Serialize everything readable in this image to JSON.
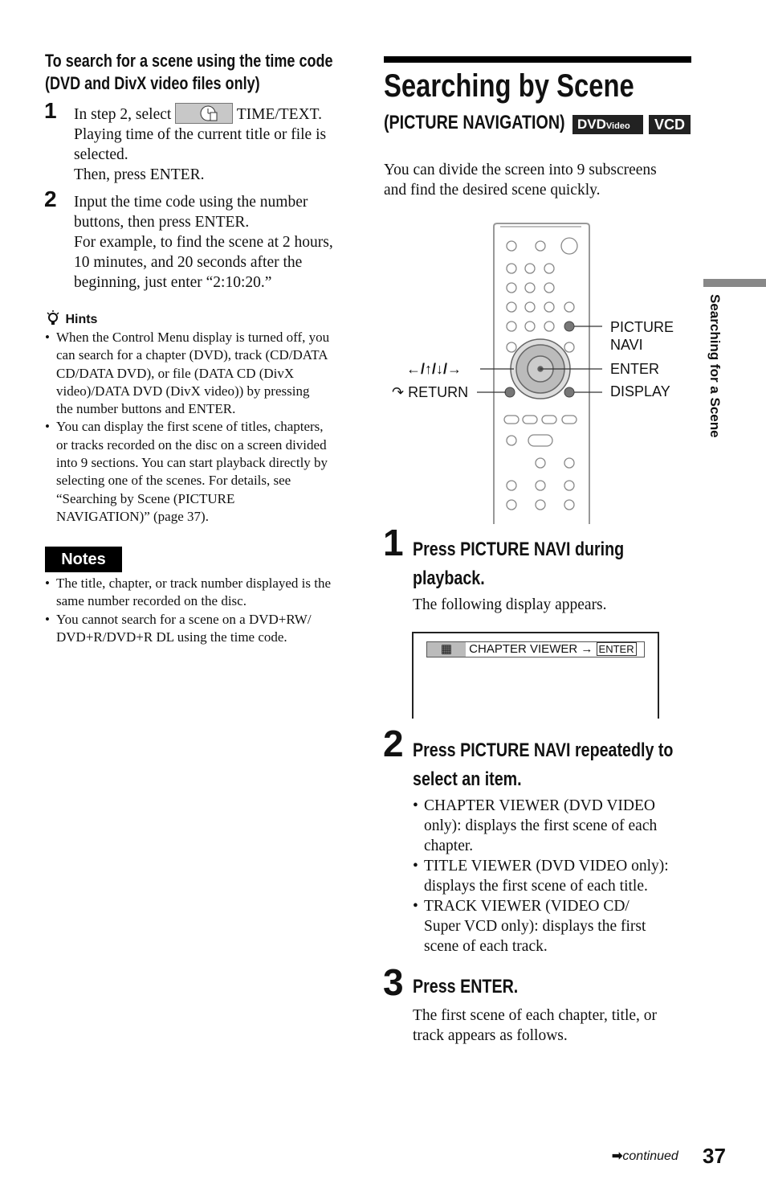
{
  "left": {
    "heading_line1": "To search for a scene using the time code",
    "heading_line2": "(DVD and DivX video files only)",
    "steps": [
      {
        "num": "1",
        "pre": "In step 2, select",
        "post": "TIME/TEXT.",
        "rest": [
          "Playing time of the current title or file is",
          "selected.",
          "Then, press ENTER."
        ]
      },
      {
        "num": "2",
        "lines": [
          "Input the time code using the number",
          "buttons, then press ENTER.",
          "For example, to find the scene at 2 hours,",
          "10 minutes, and 20 seconds after the",
          "beginning, just enter “2:10:20.”"
        ]
      }
    ],
    "hints_title": "Hints",
    "hints": [
      {
        "lines": [
          "When the Control Menu display is turned off, you",
          "can search for a chapter (DVD), track (CD/DATA",
          "CD/DATA DVD), or file (DATA CD (DivX",
          "video)/DATA DVD (DivX video)) by pressing",
          "the number buttons and ENTER."
        ]
      },
      {
        "lines": [
          "You can display the first scene of titles, chapters,",
          "or tracks recorded on the disc on a screen divided",
          "into 9 sections. You can start playback directly by",
          "selecting one of the scenes. For details, see",
          "“Searching by Scene (PICTURE",
          "NAVIGATION)” (page 37)."
        ]
      }
    ],
    "notes_title": "Notes",
    "notes": [
      {
        "lines": [
          "The title, chapter, or track number displayed is the",
          "same number recorded on the disc."
        ]
      },
      {
        "lines": [
          "You cannot search for a scene on a DVD+RW/",
          "DVD+R/DVD+R DL using the time code."
        ]
      }
    ]
  },
  "right": {
    "title": "Searching by Scene",
    "subtitle": "(PICTURE NAVIGATION)",
    "badges": {
      "dvd": "DVD",
      "dvd_small": "Video",
      "vcd": "VCD"
    },
    "intro": [
      "You can divide the screen into 9 subscreens",
      "and find the desired scene quickly."
    ],
    "remote_labels": {
      "picture_navi": [
        "PICTURE",
        "NAVI"
      ],
      "enter": "ENTER",
      "display": "DISPLAY",
      "arrows": "←/↑/↓/→",
      "return": "RETURN"
    },
    "step1": {
      "num": "1",
      "title": "Press PICTURE NAVI during",
      "title2": "playback.",
      "text": "The following display appears."
    },
    "osd": {
      "label": "CHAPTER VIEWER",
      "enter": "ENTER"
    },
    "step2": {
      "num": "2",
      "title": "Press PICTURE NAVI repeatedly to",
      "title2": "select an item.",
      "items": [
        {
          "lines": [
            "CHAPTER VIEWER (DVD VIDEO",
            "only): displays the first scene of each",
            "chapter."
          ]
        },
        {
          "lines": [
            "TITLE VIEWER (DVD VIDEO only):",
            "displays the first scene of each title."
          ]
        },
        {
          "lines": [
            "TRACK VIEWER (VIDEO CD/",
            "Super VCD only): displays the first",
            "scene of each track."
          ]
        }
      ]
    },
    "step3": {
      "num": "3",
      "title": "Press ENTER.",
      "lines": [
        "The first scene of each chapter, title, or",
        "track appears as follows."
      ]
    }
  },
  "side_tab": "Searching for a Scene",
  "footer": {
    "continued": "continued",
    "page": "37"
  }
}
